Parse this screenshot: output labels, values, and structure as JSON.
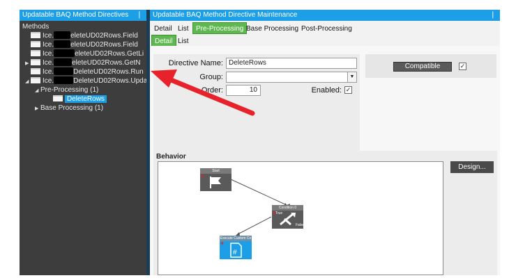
{
  "left_panel": {
    "title": "Updatable BAQ Method Directives",
    "pin": "❘",
    "root": "Methods",
    "methods": [
      {
        "prefix": "Ice.",
        "suffix": "eleteUD02Rows.Field",
        "expand": ""
      },
      {
        "prefix": "Ice.",
        "suffix": "eleteUD02Rows.Field",
        "expand": ""
      },
      {
        "prefix": "Ice.",
        "suffix": "eleteUD02Rows.GetLi",
        "expand": ""
      },
      {
        "prefix": "Ice.",
        "suffix": "eleteUD02Rows.GetN",
        "expand": "▶"
      },
      {
        "prefix": "Ice.",
        "suffix": "DeleteUD02Rows.Run",
        "expand": ""
      },
      {
        "prefix": "Ice.",
        "suffix": "DeleteUD02Rows.Upda",
        "expand": "◢"
      }
    ],
    "pre_processing": "Pre-Processing (1)",
    "selected_directive": "DeleteRows",
    "base_processing": "Base Processing (1)"
  },
  "right_panel": {
    "title": "Updatable BAQ Method Directive Maintenance",
    "pin": "❘",
    "tabs": [
      "Detail",
      "List",
      "Pre-Processing",
      "Base Processing",
      "Post-Processing"
    ],
    "subtabs": [
      "Detail",
      "List"
    ],
    "form": {
      "directive_name_label": "Directive Name:",
      "directive_name_value": "DeleteRows",
      "group_label": "Group:",
      "order_label": "Order:",
      "order_value": "10",
      "enabled_label": "Enabled:",
      "enabled_check": "✓"
    },
    "compatible_label": "Compatible",
    "compatible_check": "✓",
    "behavior": {
      "heading": "Behavior",
      "design_button": "Design...",
      "nodes": {
        "start": "Start",
        "condition": "Condition 0",
        "condition_true": "True",
        "condition_false": "False",
        "custom": "Execute Custom Co"
      }
    }
  },
  "colors": {
    "accent": "#1c9fe6",
    "active_tab": "#5fb84f",
    "annotation_arrow": "#e8222a"
  }
}
